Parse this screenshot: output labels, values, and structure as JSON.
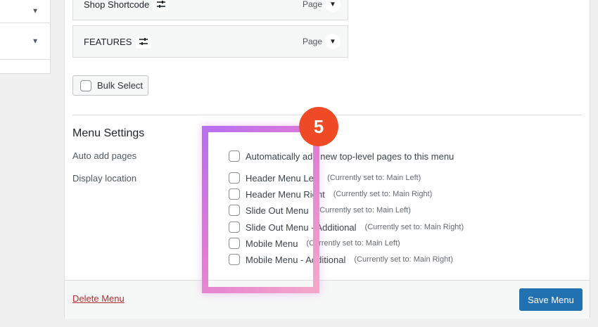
{
  "menu_items": [
    {
      "title": "Shop Shortcode",
      "type": "Page"
    },
    {
      "title": "FEATURES",
      "type": "Page"
    }
  ],
  "bulk_select_label": "Bulk Select",
  "menu_settings": {
    "heading": "Menu Settings",
    "auto_add_label": "Auto add pages",
    "auto_add_option": "Automatically add new top-level pages to this menu",
    "display_location_label": "Display location",
    "locations": [
      {
        "name": "Header Menu Left",
        "note": "(Currently set to: Main Left)"
      },
      {
        "name": "Header Menu Right",
        "note": "(Currently set to: Main Right)"
      },
      {
        "name": "Slide Out Menu",
        "note": "(Currently set to: Main Left)"
      },
      {
        "name": "Slide Out Menu - Additional",
        "note": "(Currently set to: Main Right)"
      },
      {
        "name": "Mobile Menu",
        "note": "(Currently set to: Main Left)"
      },
      {
        "name": "Mobile Menu - Additional",
        "note": "(Currently set to: Main Right)"
      }
    ]
  },
  "footer": {
    "delete_label": "Delete Menu",
    "save_label": "Save Menu"
  },
  "step_badge": "5",
  "icons": {
    "dropdown": "triangle-down-icon",
    "settings": "sliders-icon"
  },
  "colors": {
    "accent": "#2271b1",
    "delete": "#b32d2e",
    "badge": "#ee4a25",
    "highlight_start": "#b86ff0",
    "highlight_end": "#f3a7c8"
  }
}
